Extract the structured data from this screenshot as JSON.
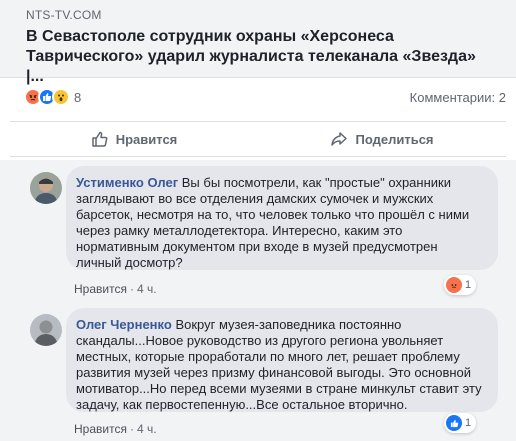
{
  "link_preview": {
    "domain": "NTS-TV.COM",
    "headline": "В Севастополе сотрудник охраны «Херсонеса Таврического» ударил журналиста телеканала «Звезда» |..."
  },
  "stats": {
    "reactions": [
      "angry-icon",
      "like-icon",
      "wow-icon"
    ],
    "reaction_count": "8",
    "comments_label": "Комментарии: 2"
  },
  "actions": {
    "like_label": "Нравится",
    "share_label": "Поделиться"
  },
  "comments": [
    {
      "author": "Устименко Олег",
      "text": "Вы бы посмотрели, как \"простые\" охранники заглядывают во все отделения дамских сумочек и мужских барсеток, несмотря на то, что человек только что прошёл с ними через рамку металлодетектора. Интересно, каким это нормативным документом при входе в музей предусмотрен личный досмотр?",
      "like_label": "Нравится",
      "time": "4 ч.",
      "reaction": "angry-icon",
      "reaction_count": "1"
    },
    {
      "author": "Олег Черненко",
      "text": "Вокруг музея-заповедника постоянно скандалы...Новое руководство из другого региона увольняет местных, которые проработали по много лет, решает проблему развития музей через призму финансовой выгоды. Это основной мотиватор...Но перед всеми музеями в стране минкульт ставит эту задачу, как первостепенную...Все остальное вторично.",
      "like_label": "Нравится",
      "time": "4 ч.",
      "reaction": "like-icon",
      "reaction_count": "1"
    }
  ]
}
